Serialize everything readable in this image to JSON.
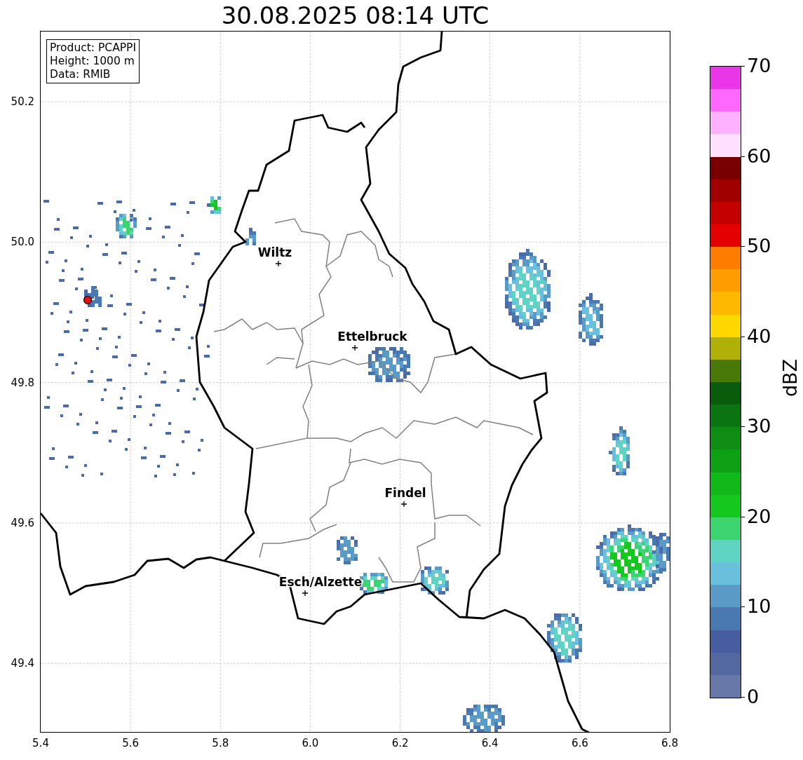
{
  "title": "30.08.2025 08:14 UTC",
  "info_box": [
    "Product: PCAPPI",
    "Height: 1000 m",
    "Data: RMIB"
  ],
  "map": {
    "x_ticks": [
      "5.4",
      "5.6",
      "5.8",
      "6.0",
      "6.2",
      "6.4",
      "6.6",
      "6.8"
    ],
    "y_ticks": [
      "50.2",
      "50.0",
      "49.8",
      "49.6",
      "49.4"
    ],
    "cities": [
      {
        "name": "Wiltz"
      },
      {
        "name": "Ettelbruck"
      },
      {
        "name": "Findel"
      },
      {
        "name": "Esch/Alzette"
      }
    ]
  },
  "colorbar": {
    "label": "dBZ",
    "ticks": [
      "70",
      "60",
      "50",
      "40",
      "30",
      "20",
      "10",
      "0"
    ],
    "bands": [
      {
        "color": "#6878a8"
      },
      {
        "color": "#5468a0"
      },
      {
        "color": "#465e9f"
      },
      {
        "color": "#4a78b0"
      },
      {
        "color": "#5a9ac6"
      },
      {
        "color": "#68c0dc"
      },
      {
        "color": "#60d4c4"
      },
      {
        "color": "#3cd470"
      },
      {
        "color": "#14c81e"
      },
      {
        "color": "#10b818"
      },
      {
        "color": "#0ea014"
      },
      {
        "color": "#0e8c14"
      },
      {
        "color": "#0a7410"
      },
      {
        "color": "#085c0c"
      },
      {
        "color": "#487808"
      },
      {
        "color": "#b0b008"
      },
      {
        "color": "#ffd800"
      },
      {
        "color": "#ffb800"
      },
      {
        "color": "#ff9c00"
      },
      {
        "color": "#ff7c00"
      },
      {
        "color": "#e40000"
      },
      {
        "color": "#c40000"
      },
      {
        "color": "#a00000"
      },
      {
        "color": "#780000"
      },
      {
        "color": "#ffe0ff"
      },
      {
        "color": "#ffb0ff"
      },
      {
        "color": "#ff68ff"
      },
      {
        "color": "#e836e8"
      }
    ]
  }
}
